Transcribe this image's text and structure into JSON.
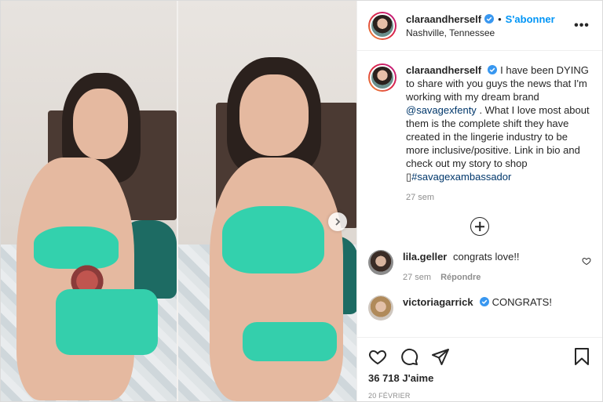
{
  "post": {
    "username": "claraandherself",
    "verified": true,
    "follow_label": "S'abonner",
    "dot": "•",
    "location": "Nashville, Tennessee",
    "more_label": "•••"
  },
  "caption": {
    "username": "claraandherself",
    "text_before_mention": "I have been DYING to share with you guys the news that I'm working with my dream brand",
    "mention": "@savagexfenty",
    "text_after_mention": ". What I love most about them is the complete shift they have created in the lingerie industry to be more inclusive/positive. Link in bio and check out my story to shop",
    "emoji_placeholder": "▯",
    "hashtag": "#savagexambassador",
    "time": "27 sem"
  },
  "comments": [
    {
      "username": "lila.geller",
      "text": "congrats love!!",
      "time": "27 sem",
      "reply_label": "Répondre"
    },
    {
      "username": "victoriagarrick",
      "text": "CONGRATS!"
    }
  ],
  "actions": {
    "likes": "36 718 J'aime",
    "date": "20 FÉVRIER"
  },
  "icons": {
    "verified": "verified-badge-icon",
    "next": "chevron-right-icon",
    "load_more": "plus-circle-icon",
    "like": "heart-icon",
    "comment": "comment-bubble-icon",
    "share": "paper-plane-icon",
    "save": "bookmark-icon"
  },
  "colors": {
    "link_blue": "#0095f6",
    "mention_blue": "#00376b",
    "verified_blue": "#3897f0",
    "secondary_text": "#8e8e8e"
  }
}
